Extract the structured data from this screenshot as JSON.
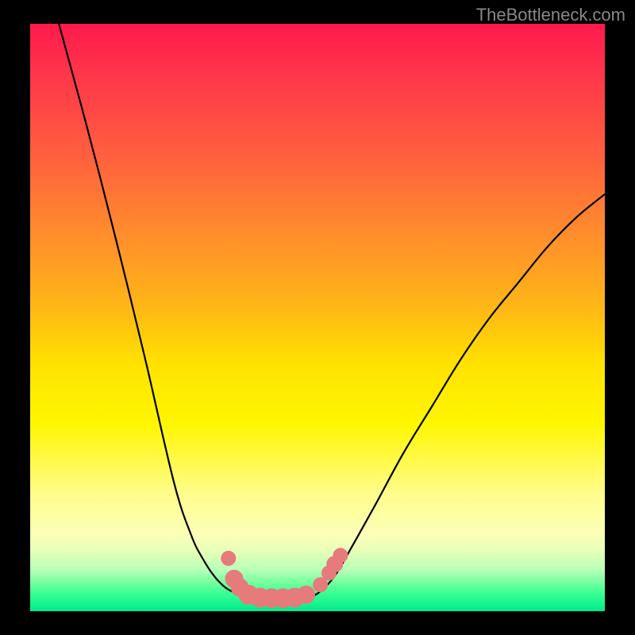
{
  "watermark": "TheBottleneck.com",
  "chart_data": {
    "type": "line",
    "title": "",
    "xlabel": "",
    "ylabel": "",
    "xlim": [
      0,
      100
    ],
    "ylim": [
      0,
      100
    ],
    "series": [
      {
        "name": "curve-left",
        "x": [
          5,
          10,
          15,
          20,
          25,
          28,
          30,
          32,
          34,
          36,
          38
        ],
        "values": [
          100,
          82,
          63,
          43,
          22,
          13,
          9,
          6,
          4,
          3,
          2.5
        ]
      },
      {
        "name": "curve-right",
        "x": [
          48,
          50,
          53,
          56,
          60,
          65,
          70,
          75,
          80,
          85,
          90,
          95,
          100
        ],
        "values": [
          2.5,
          3,
          6,
          11,
          18,
          27,
          35,
          43,
          50,
          56,
          62,
          67,
          71
        ]
      }
    ],
    "markers": [
      {
        "x": 34.5,
        "y": 9,
        "r": 9
      },
      {
        "x": 35.5,
        "y": 5.5,
        "r": 11
      },
      {
        "x": 36.5,
        "y": 4,
        "r": 11
      },
      {
        "x": 38,
        "y": 2.8,
        "r": 12
      },
      {
        "x": 40,
        "y": 2.3,
        "r": 12
      },
      {
        "x": 42,
        "y": 2.2,
        "r": 12
      },
      {
        "x": 44,
        "y": 2.2,
        "r": 12
      },
      {
        "x": 46,
        "y": 2.3,
        "r": 12
      },
      {
        "x": 48,
        "y": 2.8,
        "r": 11
      },
      {
        "x": 50.5,
        "y": 4.5,
        "r": 9
      },
      {
        "x": 52,
        "y": 6.5,
        "r": 9
      },
      {
        "x": 53,
        "y": 8,
        "r": 10
      },
      {
        "x": 54,
        "y": 9.5,
        "r": 9
      }
    ],
    "colors": {
      "curve": "#000000",
      "marker_fill": "#e77b7b",
      "marker_stroke": "#e77b7b"
    }
  }
}
